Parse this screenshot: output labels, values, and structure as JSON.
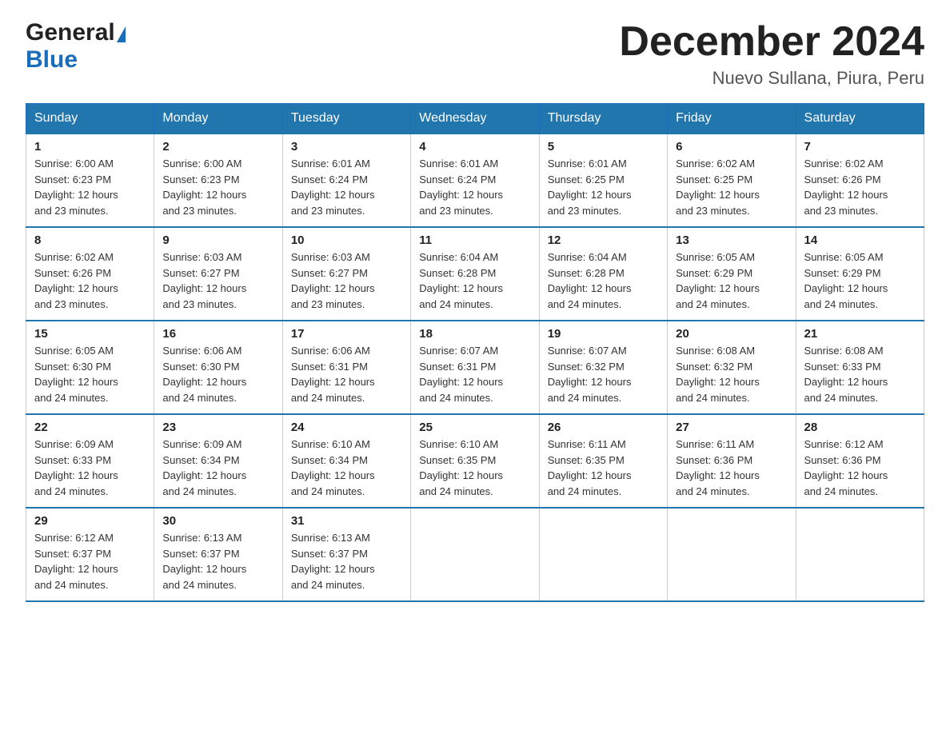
{
  "header": {
    "logo_general": "General",
    "logo_blue": "Blue",
    "month_title": "December 2024",
    "location": "Nuevo  Sullana, Piura, Peru"
  },
  "days_of_week": [
    "Sunday",
    "Monday",
    "Tuesday",
    "Wednesday",
    "Thursday",
    "Friday",
    "Saturday"
  ],
  "weeks": [
    [
      {
        "day": "1",
        "sunrise": "6:00 AM",
        "sunset": "6:23 PM",
        "daylight": "12 hours and 23 minutes."
      },
      {
        "day": "2",
        "sunrise": "6:00 AM",
        "sunset": "6:23 PM",
        "daylight": "12 hours and 23 minutes."
      },
      {
        "day": "3",
        "sunrise": "6:01 AM",
        "sunset": "6:24 PM",
        "daylight": "12 hours and 23 minutes."
      },
      {
        "day": "4",
        "sunrise": "6:01 AM",
        "sunset": "6:24 PM",
        "daylight": "12 hours and 23 minutes."
      },
      {
        "day": "5",
        "sunrise": "6:01 AM",
        "sunset": "6:25 PM",
        "daylight": "12 hours and 23 minutes."
      },
      {
        "day": "6",
        "sunrise": "6:02 AM",
        "sunset": "6:25 PM",
        "daylight": "12 hours and 23 minutes."
      },
      {
        "day": "7",
        "sunrise": "6:02 AM",
        "sunset": "6:26 PM",
        "daylight": "12 hours and 23 minutes."
      }
    ],
    [
      {
        "day": "8",
        "sunrise": "6:02 AM",
        "sunset": "6:26 PM",
        "daylight": "12 hours and 23 minutes."
      },
      {
        "day": "9",
        "sunrise": "6:03 AM",
        "sunset": "6:27 PM",
        "daylight": "12 hours and 23 minutes."
      },
      {
        "day": "10",
        "sunrise": "6:03 AM",
        "sunset": "6:27 PM",
        "daylight": "12 hours and 23 minutes."
      },
      {
        "day": "11",
        "sunrise": "6:04 AM",
        "sunset": "6:28 PM",
        "daylight": "12 hours and 24 minutes."
      },
      {
        "day": "12",
        "sunrise": "6:04 AM",
        "sunset": "6:28 PM",
        "daylight": "12 hours and 24 minutes."
      },
      {
        "day": "13",
        "sunrise": "6:05 AM",
        "sunset": "6:29 PM",
        "daylight": "12 hours and 24 minutes."
      },
      {
        "day": "14",
        "sunrise": "6:05 AM",
        "sunset": "6:29 PM",
        "daylight": "12 hours and 24 minutes."
      }
    ],
    [
      {
        "day": "15",
        "sunrise": "6:05 AM",
        "sunset": "6:30 PM",
        "daylight": "12 hours and 24 minutes."
      },
      {
        "day": "16",
        "sunrise": "6:06 AM",
        "sunset": "6:30 PM",
        "daylight": "12 hours and 24 minutes."
      },
      {
        "day": "17",
        "sunrise": "6:06 AM",
        "sunset": "6:31 PM",
        "daylight": "12 hours and 24 minutes."
      },
      {
        "day": "18",
        "sunrise": "6:07 AM",
        "sunset": "6:31 PM",
        "daylight": "12 hours and 24 minutes."
      },
      {
        "day": "19",
        "sunrise": "6:07 AM",
        "sunset": "6:32 PM",
        "daylight": "12 hours and 24 minutes."
      },
      {
        "day": "20",
        "sunrise": "6:08 AM",
        "sunset": "6:32 PM",
        "daylight": "12 hours and 24 minutes."
      },
      {
        "day": "21",
        "sunrise": "6:08 AM",
        "sunset": "6:33 PM",
        "daylight": "12 hours and 24 minutes."
      }
    ],
    [
      {
        "day": "22",
        "sunrise": "6:09 AM",
        "sunset": "6:33 PM",
        "daylight": "12 hours and 24 minutes."
      },
      {
        "day": "23",
        "sunrise": "6:09 AM",
        "sunset": "6:34 PM",
        "daylight": "12 hours and 24 minutes."
      },
      {
        "day": "24",
        "sunrise": "6:10 AM",
        "sunset": "6:34 PM",
        "daylight": "12 hours and 24 minutes."
      },
      {
        "day": "25",
        "sunrise": "6:10 AM",
        "sunset": "6:35 PM",
        "daylight": "12 hours and 24 minutes."
      },
      {
        "day": "26",
        "sunrise": "6:11 AM",
        "sunset": "6:35 PM",
        "daylight": "12 hours and 24 minutes."
      },
      {
        "day": "27",
        "sunrise": "6:11 AM",
        "sunset": "6:36 PM",
        "daylight": "12 hours and 24 minutes."
      },
      {
        "day": "28",
        "sunrise": "6:12 AM",
        "sunset": "6:36 PM",
        "daylight": "12 hours and 24 minutes."
      }
    ],
    [
      {
        "day": "29",
        "sunrise": "6:12 AM",
        "sunset": "6:37 PM",
        "daylight": "12 hours and 24 minutes."
      },
      {
        "day": "30",
        "sunrise": "6:13 AM",
        "sunset": "6:37 PM",
        "daylight": "12 hours and 24 minutes."
      },
      {
        "day": "31",
        "sunrise": "6:13 AM",
        "sunset": "6:37 PM",
        "daylight": "12 hours and 24 minutes."
      },
      null,
      null,
      null,
      null
    ]
  ],
  "labels": {
    "sunrise": "Sunrise:",
    "sunset": "Sunset:",
    "daylight": "Daylight:"
  },
  "colors": {
    "header_bg": "#2176ae",
    "header_text": "#ffffff",
    "border": "#2176ae"
  }
}
